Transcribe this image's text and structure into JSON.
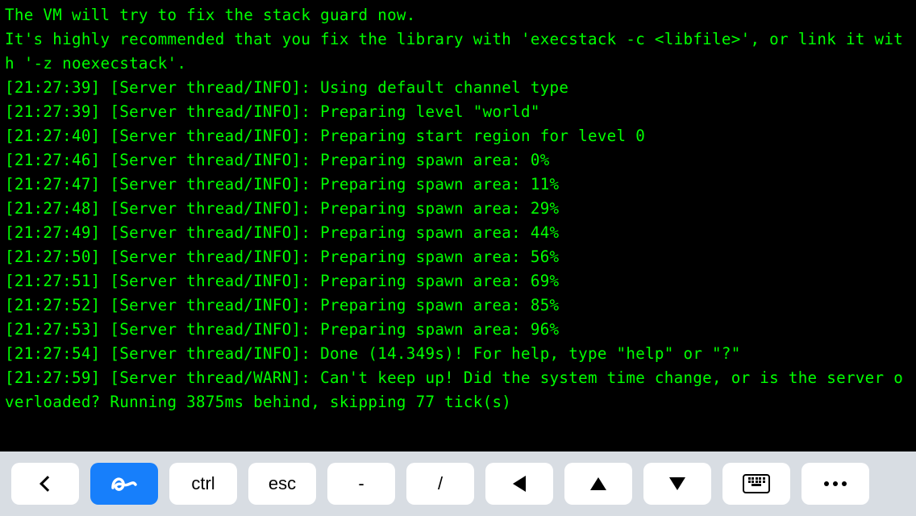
{
  "terminal": {
    "lines": [
      "The VM will try to fix the stack guard now.",
      "It's highly recommended that you fix the library with 'execstack -c <libfile>', or link it with '-z noexecstack'.",
      "[21:27:39] [Server thread/INFO]: Using default channel type",
      "[21:27:39] [Server thread/INFO]: Preparing level \"world\"",
      "[21:27:40] [Server thread/INFO]: Preparing start region for level 0",
      "[21:27:46] [Server thread/INFO]: Preparing spawn area: 0%",
      "[21:27:47] [Server thread/INFO]: Preparing spawn area: 11%",
      "[21:27:48] [Server thread/INFO]: Preparing spawn area: 29%",
      "[21:27:49] [Server thread/INFO]: Preparing spawn area: 44%",
      "[21:27:50] [Server thread/INFO]: Preparing spawn area: 56%",
      "[21:27:51] [Server thread/INFO]: Preparing spawn area: 69%",
      "[21:27:52] [Server thread/INFO]: Preparing spawn area: 85%",
      "[21:27:53] [Server thread/INFO]: Preparing spawn area: 96%",
      "[21:27:54] [Server thread/INFO]: Done (14.349s)! For help, type \"help\" or \"?\"",
      "[21:27:59] [Server thread/WARN]: Can't keep up! Did the system time change, or is the server overloaded? Running 3875ms behind, skipping 77 tick(s)"
    ]
  },
  "toolbar": {
    "back_label": "back",
    "gesture_label": "gesture",
    "ctrl_label": "ctrl",
    "esc_label": "esc",
    "dash_label": "-",
    "slash_label": "/",
    "left_label": "left",
    "up_label": "up",
    "down_label": "down",
    "keyboard_label": "keyboard",
    "more_label": "more"
  }
}
